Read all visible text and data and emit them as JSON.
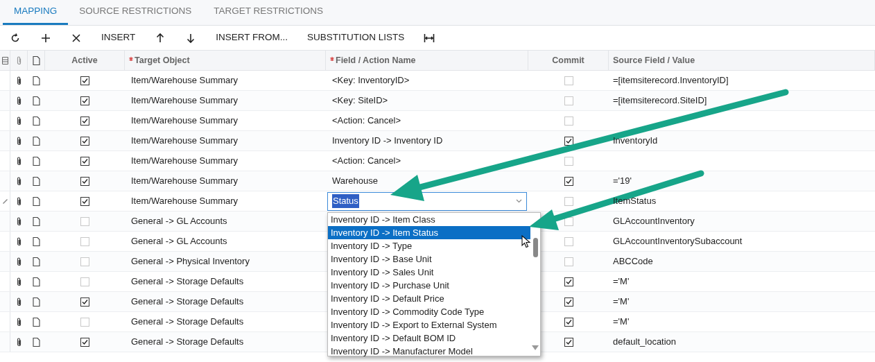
{
  "tabs": [
    {
      "label": "MAPPING",
      "selected": true
    },
    {
      "label": "SOURCE RESTRICTIONS",
      "selected": false
    },
    {
      "label": "TARGET RESTRICTIONS",
      "selected": false
    }
  ],
  "toolbar": {
    "buttons": [
      "INSERT",
      "INSERT FROM...",
      "SUBSTITUTION LISTS"
    ]
  },
  "table": {
    "columns": [
      {
        "label": "Active",
        "required": false
      },
      {
        "label": "Target Object",
        "required": true
      },
      {
        "label": "Field / Action Name",
        "required": true
      },
      {
        "label": "Commit",
        "required": false
      },
      {
        "label": "Source Field / Value",
        "required": false
      }
    ],
    "rows": [
      {
        "active": true,
        "target_object": "Item/Warehouse Summary",
        "field": "<Key: InventoryID>",
        "commit": false,
        "source": "=[itemsiterecord.InventoryID]",
        "editing": false
      },
      {
        "active": true,
        "target_object": "Item/Warehouse Summary",
        "field": "<Key: SiteID>",
        "commit": false,
        "source": "=[itemsiterecord.SiteID]",
        "editing": false
      },
      {
        "active": true,
        "target_object": "Item/Warehouse Summary",
        "field": "<Action: Cancel>",
        "commit": false,
        "editing": false
      },
      {
        "active": true,
        "target_object": "Item/Warehouse Summary",
        "field": "Inventory ID -> Inventory ID",
        "commit": true,
        "source": "InventoryId",
        "editing": false
      },
      {
        "active": true,
        "target_object": "Item/Warehouse Summary",
        "field": "<Action: Cancel>",
        "commit": false,
        "editing": false
      },
      {
        "active": true,
        "target_object": "Item/Warehouse Summary",
        "field": "Warehouse",
        "commit": true,
        "source": "='19'",
        "editing": false
      },
      {
        "active": true,
        "target_object": "Item/Warehouse Summary",
        "field": "Status",
        "commit": false,
        "source": "ItemStatus",
        "editing": true
      },
      {
        "active": false,
        "target_object": "General -> GL Accounts",
        "commit": false,
        "source": "GLAccountInventory",
        "editing": false
      },
      {
        "active": false,
        "target_object": "General -> GL Accounts",
        "commit": false,
        "source": "GLAccountInventorySubaccount",
        "editing": false
      },
      {
        "active": false,
        "target_object": "General -> Physical Inventory",
        "commit": false,
        "source": "ABCCode",
        "editing": false
      },
      {
        "active": false,
        "target_object": "General -> Storage Defaults",
        "commit": true,
        "source": "='M'",
        "editing": false
      },
      {
        "active": true,
        "target_object": "General -> Storage Defaults",
        "commit": true,
        "source": "='M'",
        "editing": false
      },
      {
        "active": false,
        "target_object": "General -> Storage Defaults",
        "commit": true,
        "source": "='M'",
        "editing": false
      },
      {
        "active": true,
        "target_object": "General -> Storage Defaults",
        "commit": true,
        "source": "default_location",
        "editing": false
      }
    ]
  },
  "dropdown": {
    "options": [
      {
        "label": "Inventory ID -> Item Class",
        "selected": false
      },
      {
        "label": "Inventory ID -> Item Status",
        "selected": true
      },
      {
        "label": "Inventory ID -> Type",
        "selected": false
      },
      {
        "label": "Inventory ID -> Base Unit",
        "selected": false
      },
      {
        "label": "Inventory ID -> Sales Unit",
        "selected": false
      },
      {
        "label": "Inventory ID -> Purchase Unit",
        "selected": false
      },
      {
        "label": "Inventory ID -> Default Price",
        "selected": false
      },
      {
        "label": "Inventory ID -> Commodity Code Type",
        "selected": false
      },
      {
        "label": "Inventory ID -> Export to External System",
        "selected": false
      },
      {
        "label": "Inventory ID -> Default BOM ID",
        "selected": false
      },
      {
        "label": "Inventory ID -> Manufacturer Model",
        "selected": false
      }
    ]
  }
}
